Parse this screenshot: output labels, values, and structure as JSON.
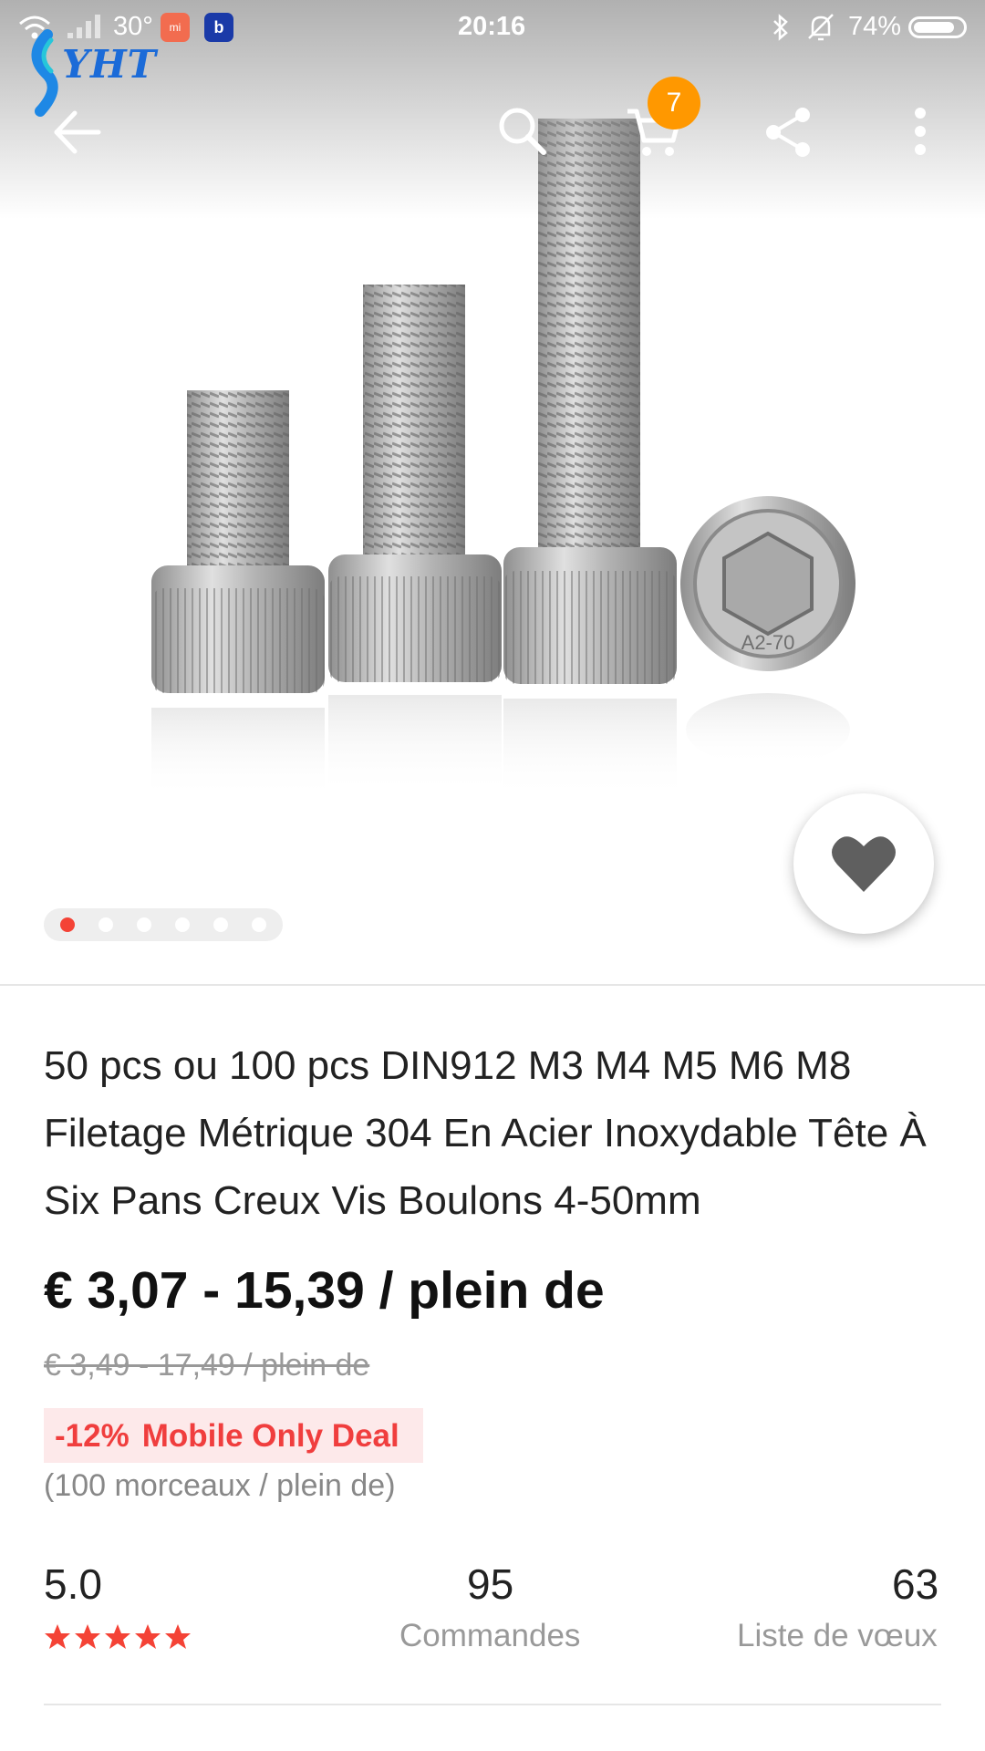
{
  "status_bar": {
    "temperature": "30°",
    "mi_icon_label": "mi",
    "b_icon_label": "b",
    "time": "20:16",
    "battery_percent": "74%",
    "battery_level": 0.74
  },
  "toolbar": {
    "cart_count": "7",
    "logo_text": "YHT"
  },
  "gallery": {
    "image_count": 6,
    "active_index": 0,
    "screw_head_marking": "A2-70"
  },
  "product": {
    "title": "50 pcs ou 100 pcs DIN912 M3 M4 M5 M6 M8 Filetage Métrique 304 En Acier Inoxydable Tête À Six Pans Creux Vis Boulons 4-50mm",
    "price": "€ 3,07 - 15,39 / plein de",
    "original_price": "€ 3,49 - 17,49 / plein de",
    "discount": "-12%",
    "deal_label": "Mobile Only Deal",
    "unit_note": "(100 morceaux / plein de)"
  },
  "stats": {
    "rating": "5.0",
    "rating_stars": 5,
    "orders_count": "95",
    "orders_label": "Commandes",
    "wishlist_count": "63",
    "wishlist_label": "Liste de vœux"
  },
  "colors": {
    "accent_red": "#f44336",
    "badge_orange": "#ff9800",
    "deal_bg": "#fde9ea"
  }
}
